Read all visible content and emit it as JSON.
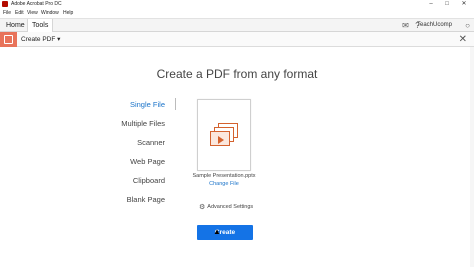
{
  "window": {
    "title": "Adobe Acrobat Pro DC",
    "minimize": "–",
    "maximize": "□",
    "close": "✕"
  },
  "menu": [
    "File",
    "Edit",
    "View",
    "Window",
    "Help"
  ],
  "topnav": {
    "tabs": [
      "Home",
      "Tools"
    ],
    "active_tab": "Tools",
    "user": "TeachUcomp"
  },
  "toolbar": {
    "tool_name": "Create PDF ▾",
    "close": "✕"
  },
  "main": {
    "heading": "Create a PDF from any format",
    "options": [
      "Single File",
      "Multiple Files",
      "Scanner",
      "Web Page",
      "Clipboard",
      "Blank Page"
    ],
    "selected_option": "Single File",
    "file_name": "Sample Presentation.pptx",
    "change_file": "Change File",
    "advanced_settings": "Advanced Settings",
    "create_button": "Create"
  },
  "colors": {
    "accent": "#1473e6",
    "tool_icon": "#e8735a",
    "pptx": "#d4622e"
  }
}
